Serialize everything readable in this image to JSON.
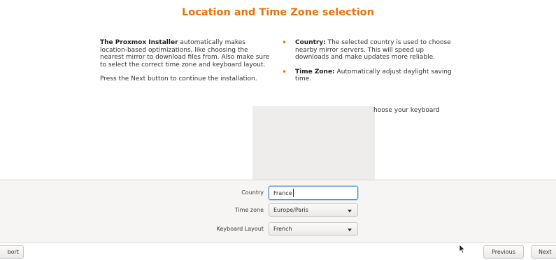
{
  "page": {
    "title": "Location and Time Zone selection"
  },
  "intro": {
    "bold_lead": "The Proxmox Installer",
    "paragraph1_rest": " automatically makes location-based optimizations, like choosing the nearest mirror to download files from. Also make sure to select the correct time zone and keyboard layout.",
    "paragraph2": "Press the Next button to continue the installation."
  },
  "bullets": [
    {
      "term": "Country:",
      "text": " The selected country is used to choose nearby mirror servers. This will speed up downloads and make updates more reliable."
    },
    {
      "term": "Time Zone:",
      "text": " Automatically adjust daylight saving time."
    }
  ],
  "partial_text": "hoose your keyboard",
  "form": {
    "country_label": "Country",
    "country_value": "France",
    "timezone_label": "Time zone",
    "timezone_value": "Europe/Paris",
    "keyboard_label": "Keyboard Layout",
    "keyboard_value": "French"
  },
  "footer": {
    "abort_label": "bort",
    "previous_label": "Previous",
    "next_label": "Next"
  },
  "colors": {
    "accent": "#e8720c",
    "focus": "#4a90d9"
  },
  "icons": {
    "bullet": "bullet-icon",
    "dropdown": "chevron-down-icon",
    "cursor": "mouse-pointer-icon"
  }
}
